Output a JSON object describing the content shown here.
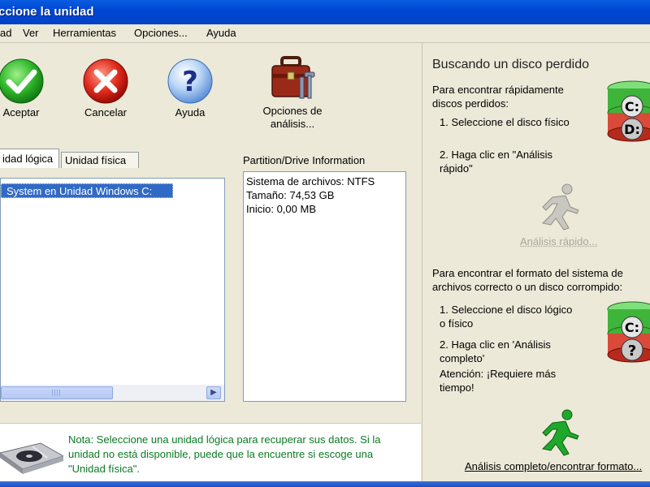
{
  "window": {
    "title": "ccione la unidad"
  },
  "menu": {
    "items": [
      "ad",
      "Ver",
      "Herramientas",
      "Opciones...",
      "Ayuda"
    ]
  },
  "toolbar": {
    "accept_label": "Aceptar",
    "cancel_label": "Cancelar",
    "help_label": "Ayuda",
    "options_label_line1": "Opciones de",
    "options_label_line2": "análisis..."
  },
  "tabs": {
    "logical": "idad lógica",
    "physical": "Unidad física"
  },
  "tree": {
    "selected_item": "System   en Unidad Windows C:"
  },
  "partition_info": {
    "title": "Partition/Drive Information",
    "filesystem": "Sistema de archivos: NTFS",
    "size": "Tamaño: 74,53 GB",
    "start": "Inicio: 0,00 MB"
  },
  "note": {
    "line1": "Nota: Seleccione una unidad lógica para recuperar sus datos. Si la",
    "line2": "unidad no está disponible, puede que la encuentre si escoge una",
    "line3": "\"Unidad física\"."
  },
  "right_panel": {
    "title": "Buscando un disco perdido",
    "quick_intro_1": "Para encontrar rápidamente",
    "quick_intro_2": "discos perdidos:",
    "quick_step1": "1. Seleccione el disco físico",
    "quick_step2_1": "2. Haga clic en \"Análisis",
    "quick_step2_2": "rápido\"",
    "quick_button": "Análisis rápido...",
    "full_intro_1": "Para encontrar el formato del sistema de",
    "full_intro_2": "archivos correcto o un disco corrompido:",
    "full_step1_1": "1. Seleccione el disco lógico",
    "full_step1_2": "o físico",
    "full_step2_1": "2. Haga clic en 'Análisis",
    "full_step2_2": "completo'",
    "full_warn_1": "Atención: ¡Requiere más",
    "full_warn_2": "tiempo!",
    "full_button": "Análisis completo/encontrar formato...",
    "disk_label_c": "C:",
    "disk_label_d": "D:",
    "disk_label_q": "?"
  },
  "colors": {
    "title_bar": "#0047d5",
    "selection": "#316ac5",
    "note_text": "#0b7a23",
    "run_green": "#1fa82b"
  }
}
